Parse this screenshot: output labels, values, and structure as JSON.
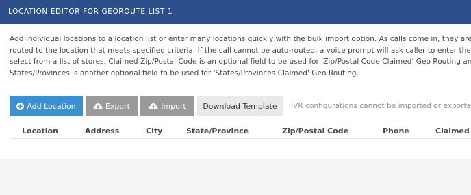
{
  "header": {
    "title": "LOCATION EDITOR FOR GEOROUTE LIST 1"
  },
  "description": {
    "lines": [
      "Add individual locations to a location list or enter many locations quickly with the bulk import option. As calls come in, they are automa",
      "routed to the location that meets specified criteria. If the call cannot be auto-routed, a voice prompt will ask caller to enter the Zip/Pos",
      "select from a list of stores. Claimed Zip/Postal Code is an optional field to be used for 'Zip/Postal Code Claimed' Geo Routing and Claim",
      "States/Provinces is another optional field to be used for 'States/Provinces Claimed' Geo Routing."
    ]
  },
  "toolbar": {
    "add_location": "Add Location",
    "export": "Export",
    "import": "Import",
    "download_template": "Download Template",
    "note": "IVR configurations cannot be imported or exported."
  },
  "table": {
    "columns": [
      "Location",
      "Address",
      "City",
      "State/Province",
      "Zip/Postal Code",
      "Phone",
      "Claimed S"
    ]
  },
  "icons": {
    "add": "plus-circle-icon",
    "export": "cloud-download-icon",
    "import": "cloud-upload-icon"
  },
  "colors": {
    "header_bg": "#2c4f8a",
    "primary_button": "#3b91d0",
    "gray_button": "#9a9a9a",
    "light_button": "#e9e9ea"
  }
}
